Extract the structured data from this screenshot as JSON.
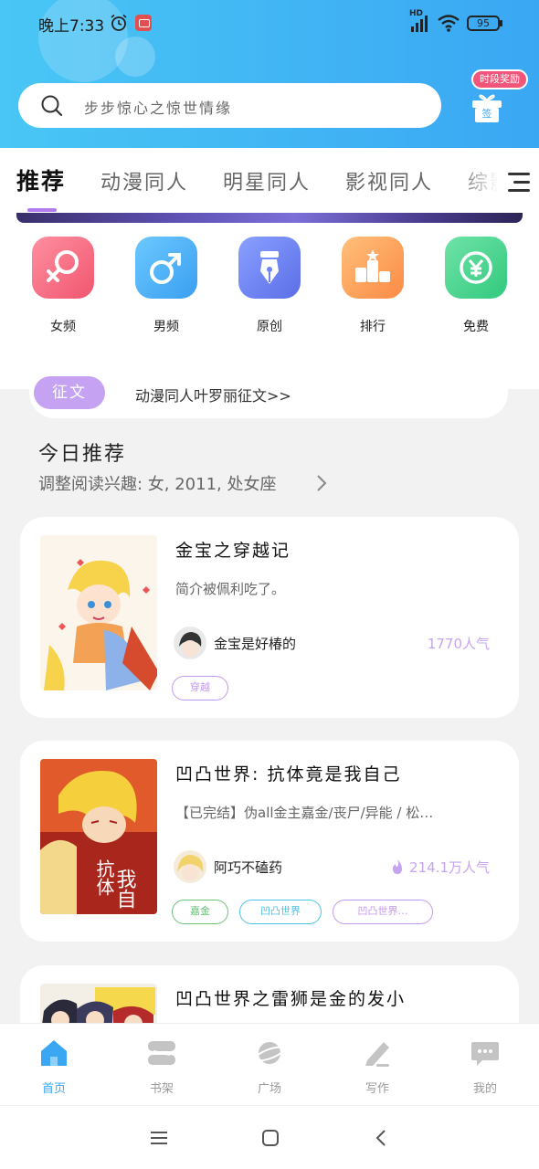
{
  "status_bar": {
    "time": "晚上7:33",
    "network": "HD",
    "battery": "95"
  },
  "search": {
    "placeholder": "步步惊心之惊世情缘"
  },
  "checkin": {
    "badge": "时段奖励",
    "label": "签"
  },
  "tabs": [
    {
      "label": "推荐",
      "active": true
    },
    {
      "label": "动漫同人",
      "active": false
    },
    {
      "label": "明星同人",
      "active": false
    },
    {
      "label": "影视同人",
      "active": false
    },
    {
      "label": "综影",
      "active": false
    }
  ],
  "categories": [
    {
      "label": "女频",
      "icon": "female-icon",
      "color": "#f66b85"
    },
    {
      "label": "男频",
      "icon": "male-icon",
      "color": "#45b0f5"
    },
    {
      "label": "原创",
      "icon": "pen-nib-icon",
      "color": "#6f84f3"
    },
    {
      "label": "排行",
      "icon": "podium-icon",
      "color": "#fb9a4e"
    },
    {
      "label": "免费",
      "icon": "yen-icon",
      "color": "#3fd18a"
    }
  ],
  "notice": {
    "badge": "征文",
    "text": "动漫同人叶罗丽征文>>"
  },
  "section": {
    "title": "今日推荐",
    "subtitle": "调整阅读兴趣: 女, 2011, 处女座"
  },
  "books": [
    {
      "title": "金宝之穿越记",
      "desc": "简介被佩利吃了。",
      "author": "金宝是好椿的",
      "popularity": "1770人气",
      "tags": [
        {
          "label": "穿越",
          "color": "#c398f0"
        }
      ]
    },
    {
      "title": "凹凸世界: 抗体竟是我自己",
      "desc": "【已完结】伪all金主嘉金/丧尸/异能 / 松…",
      "author": "阿巧不磕药",
      "popularity": "214.1万人气",
      "tags": [
        {
          "label": "嘉金",
          "color": "#6cc27a"
        },
        {
          "label": "凹凸世界",
          "color": "#4cc3e6"
        },
        {
          "label": "凹凸世界…",
          "color": "#c398f0"
        }
      ]
    },
    {
      "title": "凹凸世界之雷狮是金的发小"
    }
  ],
  "bottom_nav": [
    {
      "label": "首页",
      "icon": "home-icon",
      "active": true
    },
    {
      "label": "书架",
      "icon": "bookshelf-icon",
      "active": false
    },
    {
      "label": "广场",
      "icon": "planet-icon",
      "active": false
    },
    {
      "label": "写作",
      "icon": "write-icon",
      "active": false
    },
    {
      "label": "我的",
      "icon": "chat-icon",
      "active": false
    }
  ],
  "colors": {
    "primary": "#3aa7f3",
    "accent": "#b27cf0"
  }
}
